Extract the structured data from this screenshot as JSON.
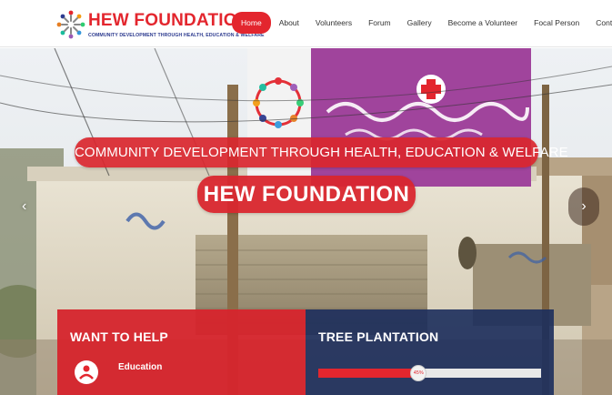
{
  "brand": {
    "name": "HEW FOUNDATION",
    "tagline": "COMMUNITY DEVELOPMENT THROUGH HEALTH, EDUCATION & WELFARE"
  },
  "nav": {
    "items": [
      "Home",
      "About",
      "Volunteers",
      "Forum",
      "Gallery",
      "Become a Volunteer",
      "Focal Person",
      "Contact"
    ],
    "active": "Home"
  },
  "hero": {
    "subtitle": "COMMUNITY DEVELOPMENT THROUGH HEALTH, EDUCATION & WELFARE",
    "title": "HEW FOUNDATION",
    "prev_icon": "chevron-left-icon",
    "next_icon": "chevron-right-icon"
  },
  "panels": {
    "help": {
      "title": "WANT TO HELP",
      "item_label": "Education",
      "item_icon": "education-icon"
    },
    "tree": {
      "title": "TREE PLANTATION",
      "progress_percent": 45,
      "progress_label": "45%"
    }
  },
  "colors": {
    "brand_red": "#e3262e",
    "brand_navy": "#2d3b8f"
  }
}
